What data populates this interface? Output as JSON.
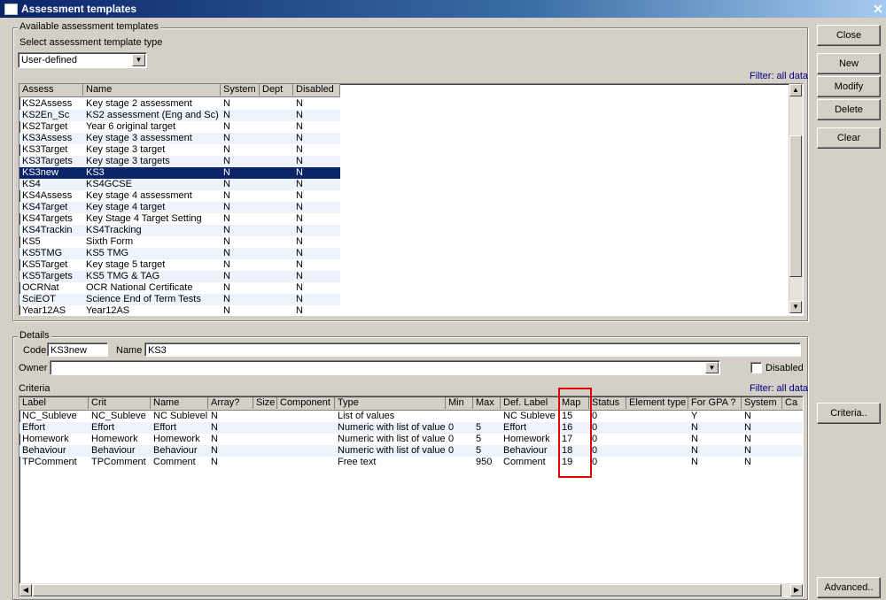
{
  "window": {
    "title": "Assessment templates"
  },
  "buttons": {
    "close": "Close",
    "new": "New",
    "modify": "Modify",
    "delete": "Delete",
    "clear": "Clear",
    "criteria": "Criteria..",
    "advanced": "Advanced.."
  },
  "templates": {
    "group_label": "Available assessment templates",
    "type_label": "Select assessment template type",
    "type_value": "User-defined",
    "filter": "Filter: all data",
    "columns": [
      "Assess",
      "Name",
      "System",
      "Dept",
      "Disabled"
    ],
    "rows": [
      [
        "KS2Assess",
        "Key stage 2 assessment",
        "N",
        "",
        "N"
      ],
      [
        "KS2En_Sc",
        "KS2 assessment (Eng and Sc)",
        "N",
        "",
        "N"
      ],
      [
        "KS2Target",
        "Year 6 original target",
        "N",
        "",
        "N"
      ],
      [
        "KS3Assess",
        "Key stage 3 assessment",
        "N",
        "",
        "N"
      ],
      [
        "KS3Target",
        "Key stage 3 target",
        "N",
        "",
        "N"
      ],
      [
        "KS3Targets",
        "Key stage 3 targets",
        "N",
        "",
        "N"
      ],
      [
        "KS3new",
        "KS3",
        "N",
        "",
        "N"
      ],
      [
        "KS4",
        "KS4GCSE",
        "N",
        "",
        "N"
      ],
      [
        "KS4Assess",
        "Key stage 4 assessment",
        "N",
        "",
        "N"
      ],
      [
        "KS4Target",
        "Key stage 4 target",
        "N",
        "",
        "N"
      ],
      [
        "KS4Targets",
        "Key Stage 4 Target Setting",
        "N",
        "",
        "N"
      ],
      [
        "KS4Trackin",
        "KS4Tracking",
        "N",
        "",
        "N"
      ],
      [
        "KS5",
        "Sixth Form",
        "N",
        "",
        "N"
      ],
      [
        "KS5TMG",
        "KS5 TMG",
        "N",
        "",
        "N"
      ],
      [
        "KS5Target",
        "Key stage 5 target",
        "N",
        "",
        "N"
      ],
      [
        "KS5Targets",
        "KS5 TMG & TAG",
        "N",
        "",
        "N"
      ],
      [
        "OCRNat",
        "OCR National Certificate",
        "N",
        "",
        "N"
      ],
      [
        "SciEOT",
        "Science End of Term Tests",
        "N",
        "",
        "N"
      ],
      [
        "Year12AS",
        "Year12AS",
        "N",
        "",
        "N"
      ]
    ],
    "selected_index": 6
  },
  "details": {
    "group_label": "Details",
    "code_label": "Code",
    "code_value": "KS3new",
    "name_label": "Name",
    "name_value": "KS3",
    "owner_label": "Owner",
    "owner_value": "",
    "disabled_label": "Disabled",
    "disabled_checked": false,
    "criteria_label": "Criteria",
    "filter": "Filter: all data",
    "columns": [
      "Label",
      "Crit",
      "Name",
      "Array?",
      "Size",
      "Component",
      "Type",
      "Min",
      "Max",
      "Def. Label",
      "Map",
      "Status",
      "Element type",
      "For GPA ?",
      "System",
      "Ca"
    ],
    "rows": [
      [
        "NC_Subleve",
        "NC_Subleve",
        "NC Sublevel",
        "N",
        "",
        "",
        "List of values",
        "",
        "",
        "NC Subleve",
        "15",
        "0",
        "",
        "Y",
        "N",
        ""
      ],
      [
        "Effort",
        "Effort",
        "Effort",
        "N",
        "",
        "",
        "Numeric with list of values",
        "0",
        "5",
        "Effort",
        "16",
        "0",
        "",
        "N",
        "N",
        ""
      ],
      [
        "Homework",
        "Homework",
        "Homework",
        "N",
        "",
        "",
        "Numeric with list of values",
        "0",
        "5",
        "Homework",
        "17",
        "0",
        "",
        "N",
        "N",
        ""
      ],
      [
        "Behaviour",
        "Behaviour",
        "Behaviour",
        "N",
        "",
        "",
        "Numeric with list of values",
        "0",
        "5",
        "Behaviour",
        "18",
        "0",
        "",
        "N",
        "N",
        ""
      ],
      [
        "TPComment",
        "TPComment",
        "Comment",
        "N",
        "",
        "",
        "Free text",
        "",
        "950",
        "Comment",
        "19",
        "0",
        "",
        "N",
        "N",
        ""
      ]
    ]
  }
}
